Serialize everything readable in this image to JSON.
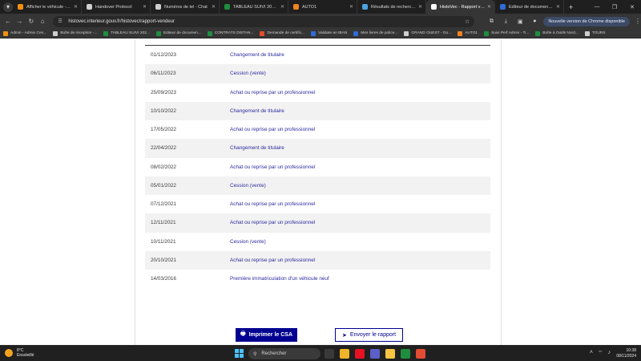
{
  "browser": {
    "tabs": [
      {
        "label": "Afficher le véhicule - Admi",
        "color": "#f29111"
      },
      {
        "label": "Handover Protocol",
        "color": "#cfcfcf"
      },
      {
        "label": "Numéros de tel - Chat",
        "color": "#cfcfcf"
      },
      {
        "label": "TABLEAU SUIVI 2024 - TO",
        "color": "#1e8e3e"
      },
      {
        "label": "AUTO1",
        "color": "#f58220"
      },
      {
        "label": "Résultats de recherche - Ch",
        "color": "#4aa3df"
      },
      {
        "label": "HistoVec - Rapport vende",
        "color": "#ffffff"
      },
      {
        "label": "Editeur de documents de",
        "color": "#2f6bd8"
      }
    ],
    "active_tab_index": 6,
    "url": "histovec.interieur.gouv.fr/histovec/rapport-vendeur",
    "update_chip": "Nouvelle version de Chrome disponible",
    "bookmarks": [
      {
        "label": "Admin - Admin Cen...",
        "color": "#f29111"
      },
      {
        "label": "Boîte de réception -...",
        "color": "#cfcfcf"
      },
      {
        "label": "TABLEAU SUIVI 202...",
        "color": "#1e8e3e"
      },
      {
        "label": "Editeur de documen...",
        "color": "#1e8e3e"
      },
      {
        "label": "CONTRATS DISTAN...",
        "color": "#1e8e3e"
      },
      {
        "label": "Demande de certific...",
        "color": "#e44c2c"
      },
      {
        "label": "Validate an IBAN",
        "color": "#2f6bd8"
      },
      {
        "label": "Mes livres de police...",
        "color": "#2f6bd8"
      },
      {
        "label": "GRAND OUEST - Go...",
        "color": "#cfcfcf"
      },
      {
        "label": "AUTO1",
        "color": "#f58220"
      },
      {
        "label": "Suivi Perf Admin - Ti...",
        "color": "#1e8e3e"
      },
      {
        "label": "Boîte à Outils Nord...",
        "color": "#1e8e3e"
      },
      {
        "label": "TOURS",
        "color": "#cfcfcf"
      }
    ]
  },
  "history": [
    {
      "date": "01/12/2023",
      "event": "Changement de titulaire"
    },
    {
      "date": "06/11/2023",
      "event": "Cession (vente)"
    },
    {
      "date": "25/09/2023",
      "event": "Achat ou reprise par un professionnel"
    },
    {
      "date": "10/10/2022",
      "event": "Changement de titulaire"
    },
    {
      "date": "17/05/2022",
      "event": "Achat ou reprise par un professionnel"
    },
    {
      "date": "22/04/2022",
      "event": "Changement de titulaire"
    },
    {
      "date": "08/02/2022",
      "event": "Achat ou reprise par un professionnel"
    },
    {
      "date": "05/01/2022",
      "event": "Cession (vente)"
    },
    {
      "date": "07/12/2021",
      "event": "Achat ou reprise par un professionnel"
    },
    {
      "date": "12/11/2021",
      "event": "Achat ou reprise par un professionnel"
    },
    {
      "date": "10/11/2021",
      "event": "Cession (vente)"
    },
    {
      "date": "20/10/2021",
      "event": "Achat ou reprise par un professionnel"
    },
    {
      "date": "14/03/2016",
      "event": "Première immatriculation d'un véhicule neuf"
    }
  ],
  "actions": {
    "print_label": "Imprimer le CSA",
    "send_label": "Envoyer le rapport"
  },
  "taskbar": {
    "weather_temp": "8°C",
    "weather_desc": "Ensoleillé",
    "search_placeholder": "Rechercher",
    "time": "10:38",
    "date": "08/11/2024",
    "app_colors": [
      "#3a3a3a",
      "#f0b429",
      "#e81123",
      "#5b5fc7",
      "#f5c542",
      "#1e8e3e",
      "#e34b32"
    ]
  }
}
